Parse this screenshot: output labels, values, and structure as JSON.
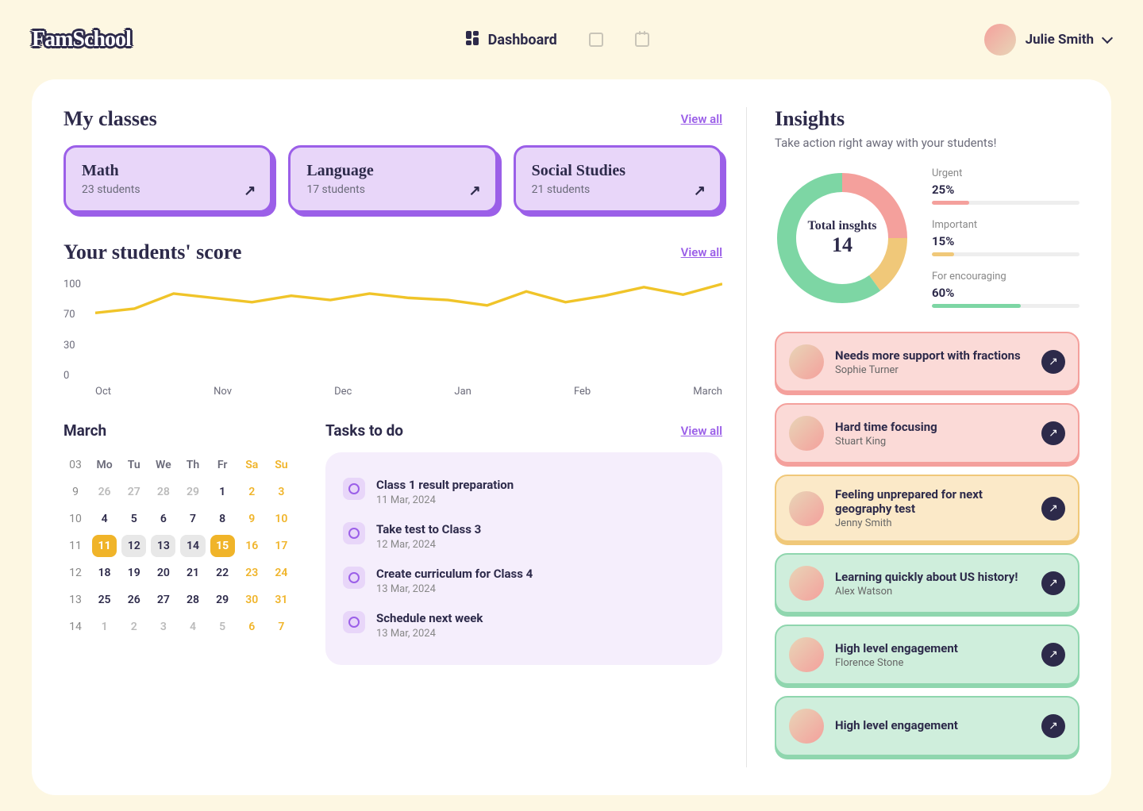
{
  "brand": "FamSchool",
  "nav": {
    "dashboard": "Dashboard"
  },
  "user": {
    "name": "Julie Smith"
  },
  "classes": {
    "title": "My classes",
    "view_all": "View all",
    "items": [
      {
        "name": "Math",
        "students": "23 students"
      },
      {
        "name": "Language",
        "students": "17 students"
      },
      {
        "name": "Social Studies",
        "students": "21 students"
      }
    ]
  },
  "scores": {
    "title": "Your students' score",
    "view_all": "View all"
  },
  "chart_data": {
    "type": "line",
    "title": "Your students' score",
    "ylabel": "",
    "xlabel": "",
    "ylim": [
      0,
      100
    ],
    "yticks": [
      0,
      30,
      70,
      100
    ],
    "categories": [
      "Oct",
      "Nov",
      "Dec",
      "Jan",
      "Feb",
      "March"
    ],
    "values": [
      68,
      72,
      86,
      82,
      78,
      84,
      80,
      86,
      82,
      80,
      75,
      88,
      78,
      84,
      92,
      85,
      95
    ]
  },
  "calendar": {
    "month": "March",
    "dow": [
      "Mo",
      "Tu",
      "We",
      "Th",
      "Fr",
      "Sa",
      "Su"
    ],
    "weeks": [
      "03",
      "9",
      "10",
      "11",
      "12",
      "13",
      "14"
    ],
    "grid": [
      [
        "26",
        "27",
        "28",
        "29",
        "1",
        "2",
        "3"
      ],
      [
        "4",
        "5",
        "6",
        "7",
        "8",
        "9",
        "10"
      ],
      [
        "11",
        "12",
        "13",
        "14",
        "15",
        "16",
        "17"
      ],
      [
        "18",
        "19",
        "20",
        "21",
        "22",
        "23",
        "24"
      ],
      [
        "25",
        "26",
        "27",
        "28",
        "29",
        "30",
        "31"
      ],
      [
        "1",
        "2",
        "3",
        "4",
        "5",
        "6",
        "7"
      ]
    ]
  },
  "tasks": {
    "title": "Tasks to do",
    "view_all": "View all",
    "items": [
      {
        "title": "Class 1 result preparation",
        "date": "11 Mar, 2024"
      },
      {
        "title": "Take test to Class 3",
        "date": "12 Mar, 2024"
      },
      {
        "title": "Create curriculum for Class 4",
        "date": "13 Mar, 2024"
      },
      {
        "title": "Schedule next week",
        "date": "13 Mar, 2024"
      }
    ]
  },
  "insights": {
    "title": "Insights",
    "sub": "Take action right away with your students!",
    "donut": {
      "label": "Total insghts",
      "value": "14"
    },
    "stats": [
      {
        "label": "Urgent",
        "value": "25%",
        "pct": 25,
        "color": "#F4A09C"
      },
      {
        "label": "Important",
        "value": "15%",
        "pct": 15,
        "color": "#F0C879"
      },
      {
        "label": "For encouraging",
        "value": "60%",
        "pct": 60,
        "color": "#7DD6A4"
      }
    ],
    "cards": [
      {
        "title": "Needs more support with fractions",
        "name": "Sophie Turner",
        "type": "red"
      },
      {
        "title": "Hard time focusing",
        "name": "Stuart King",
        "type": "red"
      },
      {
        "title": "Feeling unprepared for next geography test",
        "name": "Jenny Smith",
        "type": "orange"
      },
      {
        "title": "Learning quickly about US history!",
        "name": "Alex Watson",
        "type": "green"
      },
      {
        "title": "High level engagement",
        "name": "Florence Stone",
        "type": "green"
      },
      {
        "title": "High level engagement",
        "name": "",
        "type": "green"
      }
    ]
  }
}
